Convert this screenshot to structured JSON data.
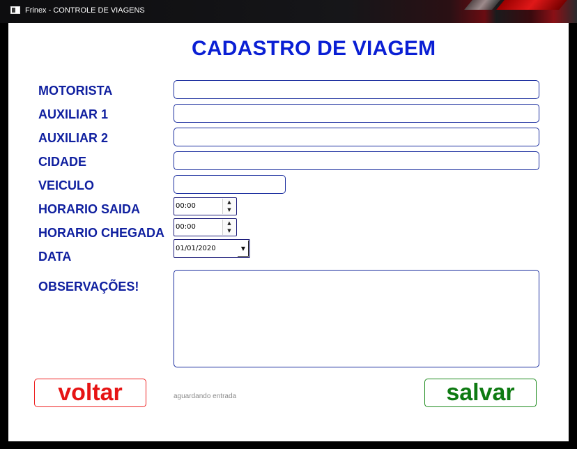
{
  "window": {
    "title": "Frinex - CONTROLE DE VIAGENS"
  },
  "form": {
    "heading": "CADASTRO DE VIAGEM",
    "labels": {
      "motorista": "MOTORISTA",
      "auxiliar1": "AUXILIAR 1",
      "auxiliar2": "AUXILIAR 2",
      "cidade": "CIDADE",
      "veiculo": "VEICULO",
      "horario_saida": "HORARIO SAIDA",
      "horario_chegada": "HORARIO CHEGADA",
      "data": "DATA",
      "observacoes": "OBSERVAÇÕES!"
    },
    "values": {
      "motorista": "",
      "auxiliar1": "",
      "auxiliar2": "",
      "cidade": "",
      "veiculo": "",
      "horario_saida": "00:00",
      "horario_chegada": "00:00",
      "data": "01/01/2020",
      "observacoes": ""
    }
  },
  "buttons": {
    "voltar": "voltar",
    "salvar": "salvar"
  },
  "status_text": "aguardando entrada",
  "colors": {
    "heading": "#0a1fd4",
    "label": "#0f1f9f",
    "voltar": "#e61414",
    "salvar": "#0e7a12"
  },
  "icons": {
    "spin_up": "▲",
    "spin_down": "▼",
    "dropdown": "▼"
  }
}
